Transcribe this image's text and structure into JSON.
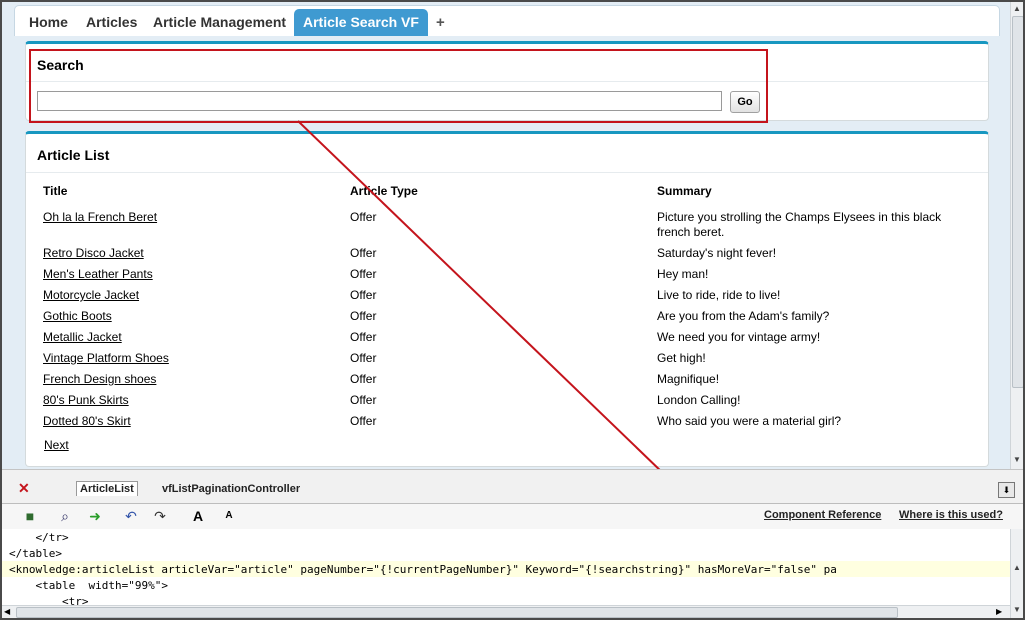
{
  "tabs": [
    "Home",
    "Articles",
    "Article Management",
    "Article Search VF",
    "+"
  ],
  "search": {
    "title": "Search",
    "value": "",
    "go_label": "Go"
  },
  "article_list": {
    "title": "Article List",
    "headers": [
      "Title",
      "Article Type",
      "Summary"
    ],
    "rows": [
      {
        "title": "Oh la la French Beret",
        "type": "Offer",
        "summary": "Picture you strolling the Champs Elysees in this black french beret."
      },
      {
        "title": "Retro Disco Jacket",
        "type": "Offer",
        "summary": "Saturday's night fever!"
      },
      {
        "title": "Men's Leather Pants",
        "type": "Offer",
        "summary": "Hey man!"
      },
      {
        "title": "Motorcycle Jacket",
        "type": "Offer",
        "summary": "Live to ride, ride to live!"
      },
      {
        "title": "Gothic Boots",
        "type": "Offer",
        "summary": "Are you from the Adam's family?"
      },
      {
        "title": "Metallic Jacket",
        "type": "Offer",
        "summary": "We need you for vintage army!"
      },
      {
        "title": "Vintage Platform Shoes",
        "type": "Offer",
        "summary": "Get high!"
      },
      {
        "title": "French Design shoes",
        "type": "Offer",
        "summary": "Magnifique!"
      },
      {
        "title": "80's Punk Skirts",
        "type": "Offer",
        "summary": "London Calling!"
      },
      {
        "title": "Dotted 80's Skirt",
        "type": "Offer",
        "summary": "Who said you were a material girl?"
      }
    ],
    "next_label": "Next"
  },
  "dev": {
    "tabs": [
      "ArticleList",
      "vfListPaginationController"
    ],
    "links": [
      "Component Reference",
      "Where is this used?"
    ],
    "code": [
      "    </tr>",
      "</table>",
      "<knowledge:articleList articleVar=\"article\" pageNumber=\"{!currentPageNumber}\" Keyword=\"{!searchstring}\" hasMoreVar=\"false\" pa",
      "    <table  width=\"99%\">",
      "        <tr>"
    ]
  }
}
